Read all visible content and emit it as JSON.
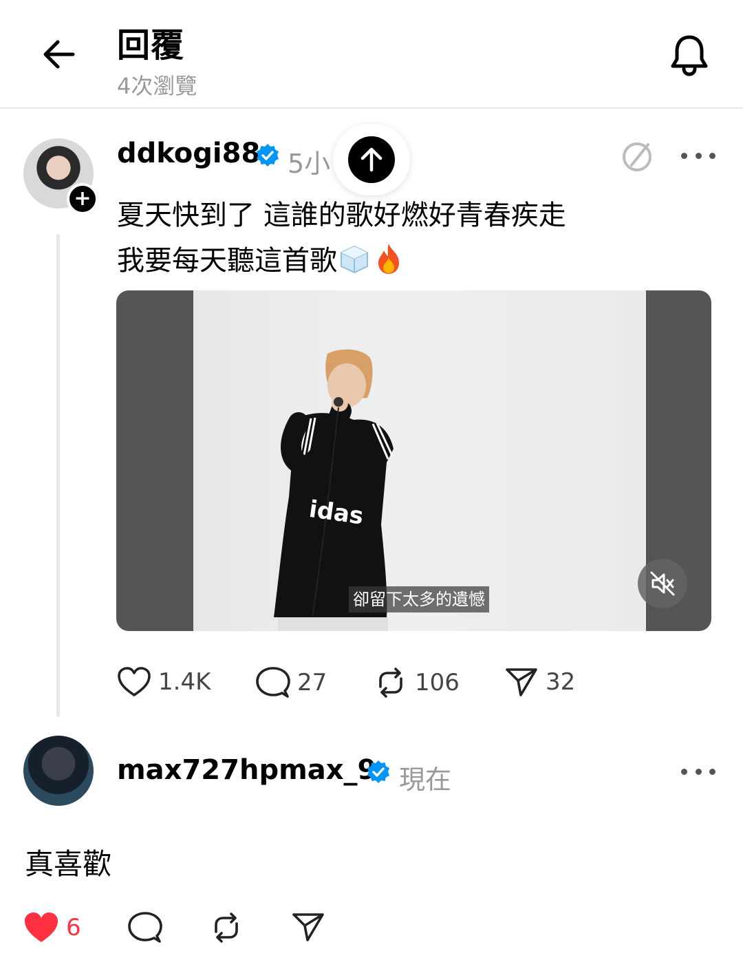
{
  "header": {
    "title": "回覆",
    "subtitle": "4次瀏覽",
    "back_icon": "arrow-left-icon",
    "notification_icon": "bell-icon"
  },
  "post": {
    "username": "ddkogi88",
    "verified": true,
    "time_visible": "5小",
    "text_line1": "夏天快到了 這誰的歌好燃好青春疾走",
    "text_line2": "我要每天聽這首歌",
    "emojis": [
      "ice-cube",
      "fire"
    ],
    "video": {
      "subtitle": "卻留下太多的遺憾",
      "muted": true
    },
    "stats": {
      "likes": "1.4K",
      "replies": "27",
      "reposts": "106",
      "shares": "32"
    }
  },
  "reply": {
    "username": "max727hpmax_9",
    "verified": true,
    "time": "現在",
    "text": "真喜歡",
    "likes": "6",
    "liked": true
  },
  "colors": {
    "verified_blue": "#0095f6",
    "like_red": "#ff3040",
    "muted_text": "#999999"
  }
}
